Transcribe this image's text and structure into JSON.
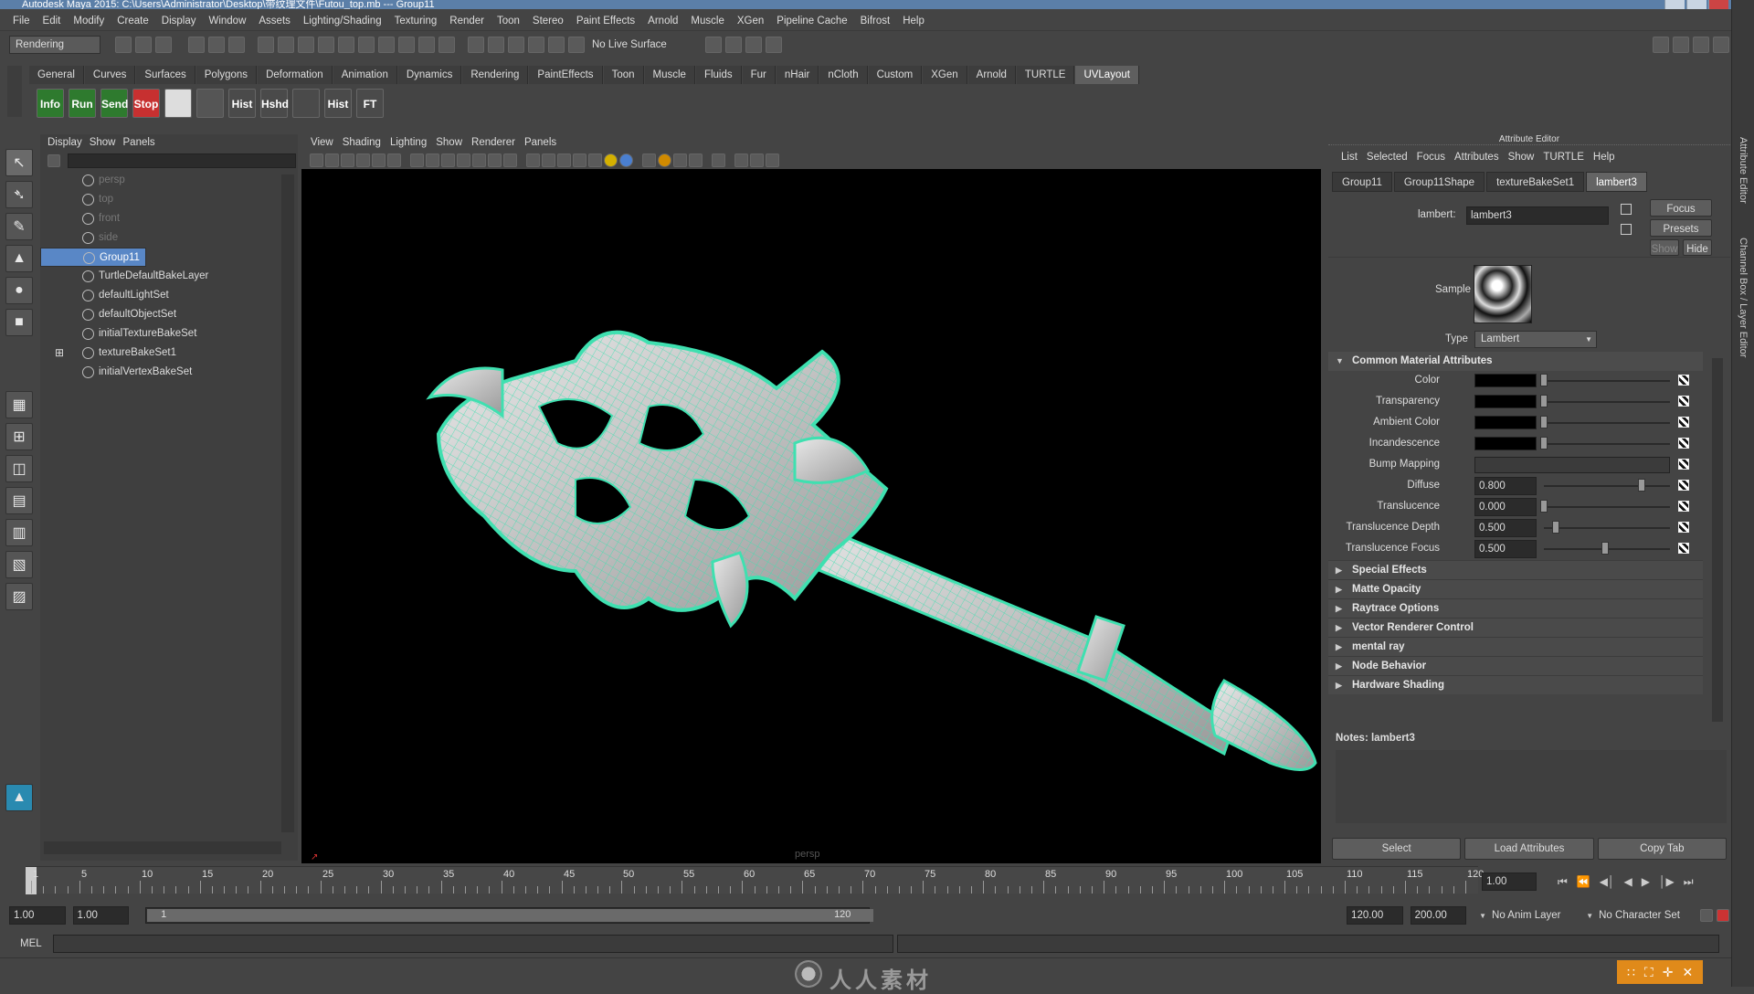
{
  "window": {
    "title": "Autodesk Maya 2015: C:\\Users\\Administrator\\Desktop\\带纹理文件\\Futou_top.mb  ---  Group11"
  },
  "menubar": [
    "File",
    "Edit",
    "Modify",
    "Create",
    "Display",
    "Window",
    "Assets",
    "Lighting/Shading",
    "Texturing",
    "Render",
    "Toon",
    "Stereo",
    "Paint Effects",
    "Arnold",
    "Muscle",
    "XGen",
    "Pipeline Cache",
    "Bifrost",
    "Help"
  ],
  "status_line": {
    "mode": "Rendering",
    "live_surface": "No Live Surface"
  },
  "shelf": {
    "tabs": [
      "General",
      "Curves",
      "Surfaces",
      "Polygons",
      "Deformation",
      "Animation",
      "Dynamics",
      "Rendering",
      "PaintEffects",
      "Toon",
      "Muscle",
      "Fluids",
      "Fur",
      "nHair",
      "nCloth",
      "Custom",
      "XGen",
      "Arnold",
      "TURTLE",
      "UVLayout"
    ],
    "active_tab": "UVLayout",
    "buttons": [
      "Info",
      "Run",
      "Send",
      "Stop",
      "",
      "",
      "Hist",
      "Hshd",
      "",
      "Hist",
      "FT"
    ]
  },
  "outliner": {
    "menu": [
      "Display",
      "Show",
      "Panels"
    ],
    "items": [
      {
        "label": "persp",
        "dim": true
      },
      {
        "label": "top",
        "dim": true
      },
      {
        "label": "front",
        "dim": true
      },
      {
        "label": "side",
        "dim": true
      },
      {
        "label": "Group11",
        "selected": true
      },
      {
        "label": "TurtleDefaultBakeLayer"
      },
      {
        "label": "defaultLightSet"
      },
      {
        "label": "defaultObjectSet"
      },
      {
        "label": "initialTextureBakeSet"
      },
      {
        "label": "textureBakeSet1",
        "expandable": true
      },
      {
        "label": "initialVertexBakeSet"
      }
    ]
  },
  "viewport": {
    "menu": [
      "View",
      "Shading",
      "Lighting",
      "Show",
      "Renderer",
      "Panels"
    ],
    "camera_label": "persp",
    "wire_color": "#3fe0b0"
  },
  "attribute_editor": {
    "header": "Attribute Editor",
    "menu": [
      "List",
      "Selected",
      "Focus",
      "Attributes",
      "Show",
      "TURTLE",
      "Help"
    ],
    "tabs": [
      "Group11",
      "Group11Shape",
      "textureBakeSet1",
      "lambert3"
    ],
    "active_tab": "lambert3",
    "node_label": "lambert:",
    "node_name": "lambert3",
    "buttons": {
      "focus": "Focus",
      "presets": "Presets",
      "show": "Show",
      "hide": "Hide"
    },
    "sample_label": "Sample",
    "type_label": "Type",
    "type_value": "Lambert",
    "common_section": "Common Material Attributes",
    "attributes": [
      {
        "label": "Color",
        "kind": "swatch",
        "level": 0.0
      },
      {
        "label": "Transparency",
        "kind": "swatch",
        "level": 0.0
      },
      {
        "label": "Ambient Color",
        "kind": "swatch",
        "level": 0.0
      },
      {
        "label": "Incandescence",
        "kind": "swatch",
        "level": 0.0
      },
      {
        "label": "Bump Mapping",
        "kind": "bump"
      },
      {
        "label": "Diffuse",
        "kind": "value",
        "value": "0.800",
        "level": 0.8
      },
      {
        "label": "Translucence",
        "kind": "value",
        "value": "0.000",
        "level": 0.0
      },
      {
        "label": "Translucence Depth",
        "kind": "value",
        "value": "0.500",
        "level": 0.1
      },
      {
        "label": "Translucence Focus",
        "kind": "value",
        "value": "0.500",
        "level": 0.5
      }
    ],
    "sections": [
      "Special Effects",
      "Matte Opacity",
      "Raytrace Options",
      "Vector Renderer Control",
      "mental ray",
      "Node Behavior",
      "Hardware Shading"
    ],
    "notes": "Notes:  lambert3",
    "bottom_buttons": [
      "Select",
      "Load Attributes",
      "Copy Tab"
    ]
  },
  "timeline": {
    "ticks": [
      "1",
      "5",
      "10",
      "15",
      "20",
      "25",
      "30",
      "35",
      "40",
      "45",
      "50",
      "55",
      "60",
      "65",
      "70",
      "75",
      "80",
      "85",
      "90",
      "95",
      "100",
      "105",
      "110",
      "115",
      "120"
    ],
    "current_frame": "1.00"
  },
  "range_slider": {
    "start": "1.00",
    "start2": "1.00",
    "inner_start": "1",
    "inner_end": "120",
    "end": "120.00",
    "end2": "200.00",
    "anim_layer": "No Anim Layer",
    "character_set": "No Character Set"
  },
  "command_line": {
    "label": "MEL"
  },
  "watermark": "人人素材",
  "side_tabs": [
    "Attribute Editor",
    "Channel Box / Layer Editor"
  ]
}
